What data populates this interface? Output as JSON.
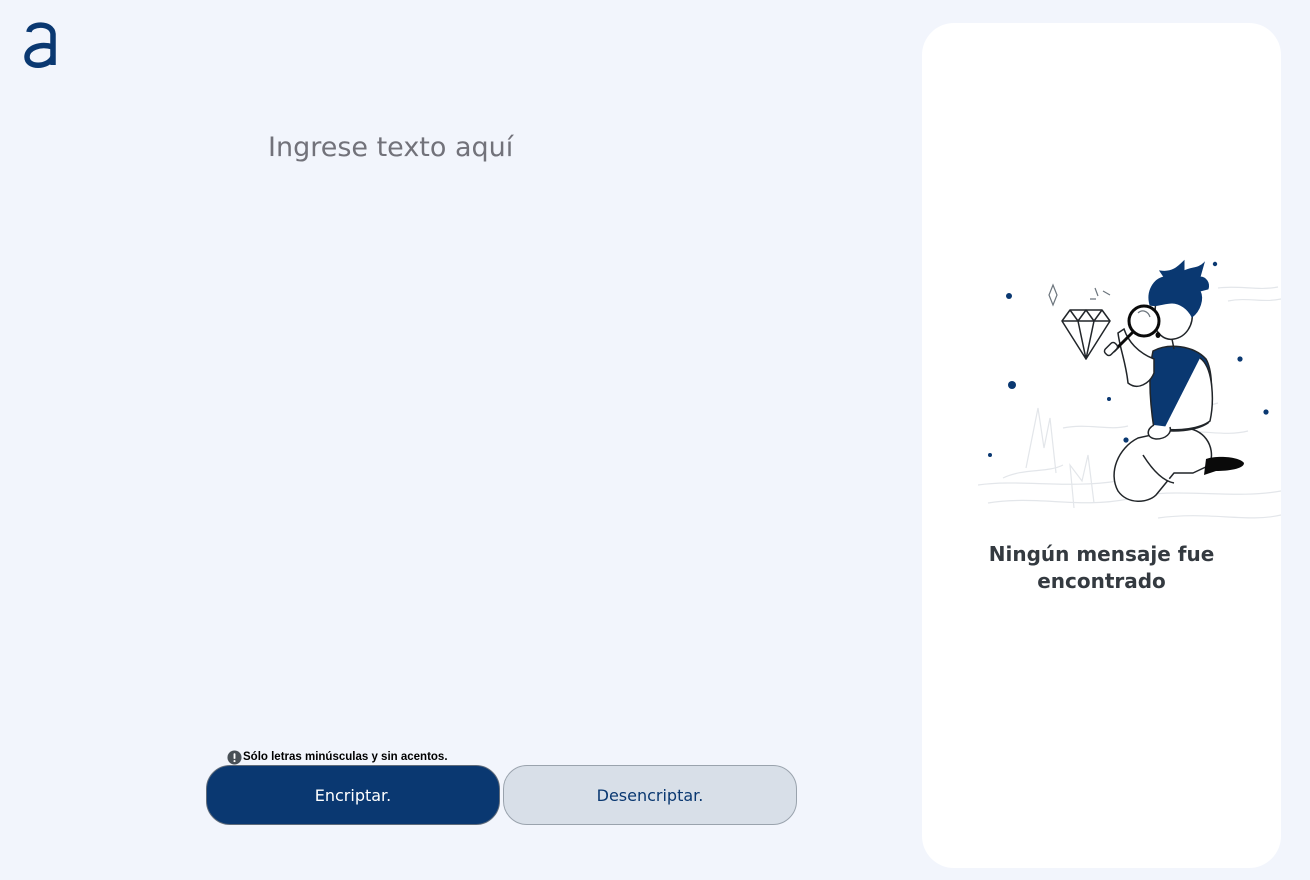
{
  "logo": {
    "icon": "alura-logo-icon",
    "color": "#0a3871"
  },
  "input": {
    "placeholder": "Ingrese texto aquí",
    "value": ""
  },
  "hint": {
    "icon": "exclamation-circle-icon",
    "text": "Sólo letras minúsculas y sin acentos."
  },
  "buttons": {
    "encrypt_label": "Encriptar.",
    "decrypt_label": "Desencriptar."
  },
  "output": {
    "illustration": "person-with-magnifying-glass-illustration",
    "empty_title": "Ningún mensaje fue encontrado"
  },
  "colors": {
    "background": "#f2f5fc",
    "primary": "#0a3871",
    "secondary_button": "#d8dfe8",
    "panel": "#ffffff",
    "placeholder_text": "#72727a"
  }
}
